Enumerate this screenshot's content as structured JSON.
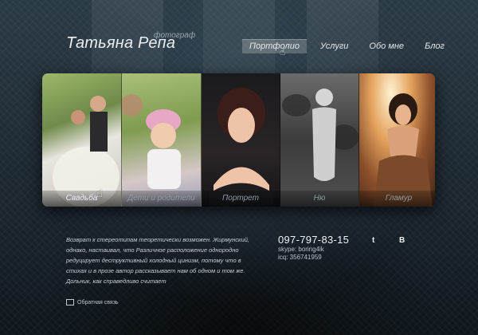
{
  "logo": {
    "name": "Татьяна Репа",
    "subtitle": "фотограф"
  },
  "nav": {
    "items": [
      {
        "label": "Портфолио",
        "active": true
      },
      {
        "label": "Услуги"
      },
      {
        "label": "Обо мне"
      },
      {
        "label": "Блог"
      }
    ]
  },
  "gallery": {
    "tiles": [
      {
        "label": "Свадьба"
      },
      {
        "label": "Дети и родители"
      },
      {
        "label": "Портрет"
      },
      {
        "label": "Ню"
      },
      {
        "label": "Гламур"
      }
    ]
  },
  "about": {
    "text": "Возврат к стереотипам теоретически возможен. Жирмунский, однако, настаивал, что Различное расположение однородно редуцирует деструктивный холодный цинизм, потому что в стихах и в прозе автор рассказывает нам об одном и том же. Дольник, как справедливо считает"
  },
  "feedback": {
    "label": "Обратная связь"
  },
  "contacts": {
    "phone": "097-797-83-15",
    "skype": "skype: boring4ik",
    "icq": "icq: 356741959"
  },
  "social": {
    "twitter": "t",
    "vk": "В"
  }
}
